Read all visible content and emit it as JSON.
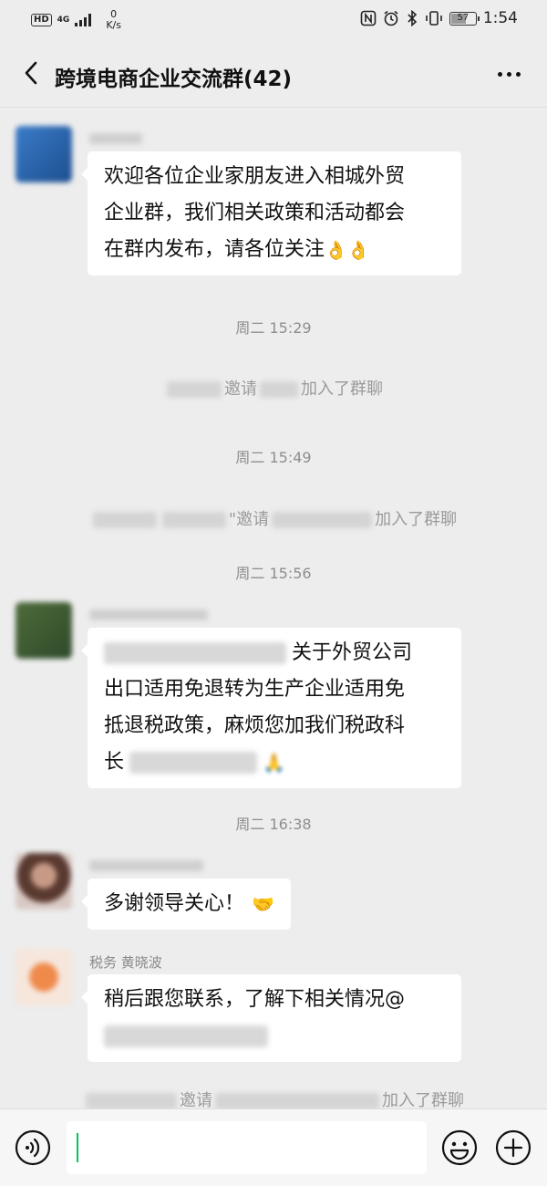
{
  "status_bar": {
    "hd": "HD",
    "network": "4G",
    "speed_value": "0",
    "speed_unit": "K/s",
    "battery": "57",
    "time": "1:54",
    "icons": [
      "nfc-icon",
      "alarm-icon",
      "bluetooth-icon",
      "vibrate-icon"
    ]
  },
  "header": {
    "title": "跨境电商企业交流群(42)"
  },
  "messages": [
    {
      "type": "text",
      "lines": [
        "欢迎各位企业家朋友进入相城外贸",
        "企业群，我们相关政策和活动都会",
        "在群内发布，请各位关注"
      ],
      "emoji": "👌👌"
    },
    {
      "type": "time",
      "text": "周二 15:29"
    },
    {
      "type": "system",
      "verb": "邀请",
      "tail": "加入了群聊"
    },
    {
      "type": "time",
      "text": "周二 15:49"
    },
    {
      "type": "system",
      "verb": "\"邀请",
      "tail": "加入了群聊"
    },
    {
      "type": "time",
      "text": "周二 15:56"
    },
    {
      "type": "text",
      "first_tail": "关于外贸公司",
      "lines": [
        "出口适用免退转为生产企业适用免",
        "抵退税政策，麻烦您加我们税政科"
      ],
      "last_prefix": "长",
      "emoji": "🙏"
    },
    {
      "type": "time",
      "text": "周二 16:38"
    },
    {
      "type": "text",
      "text": "多谢领导关心！",
      "emoji": "🤝"
    },
    {
      "type": "text",
      "sender": "税务 黄晓波",
      "text": "稍后跟您联系，了解下相关情况@"
    },
    {
      "type": "system",
      "verb": "邀请",
      "tail": "加入了群聊"
    }
  ],
  "input_bar": {
    "placeholder": "",
    "icons": [
      "voice-icon",
      "emoji-icon",
      "plus-icon"
    ]
  },
  "colors": {
    "background": "#ededed",
    "bubble": "#ffffff",
    "caret": "#07c160"
  }
}
